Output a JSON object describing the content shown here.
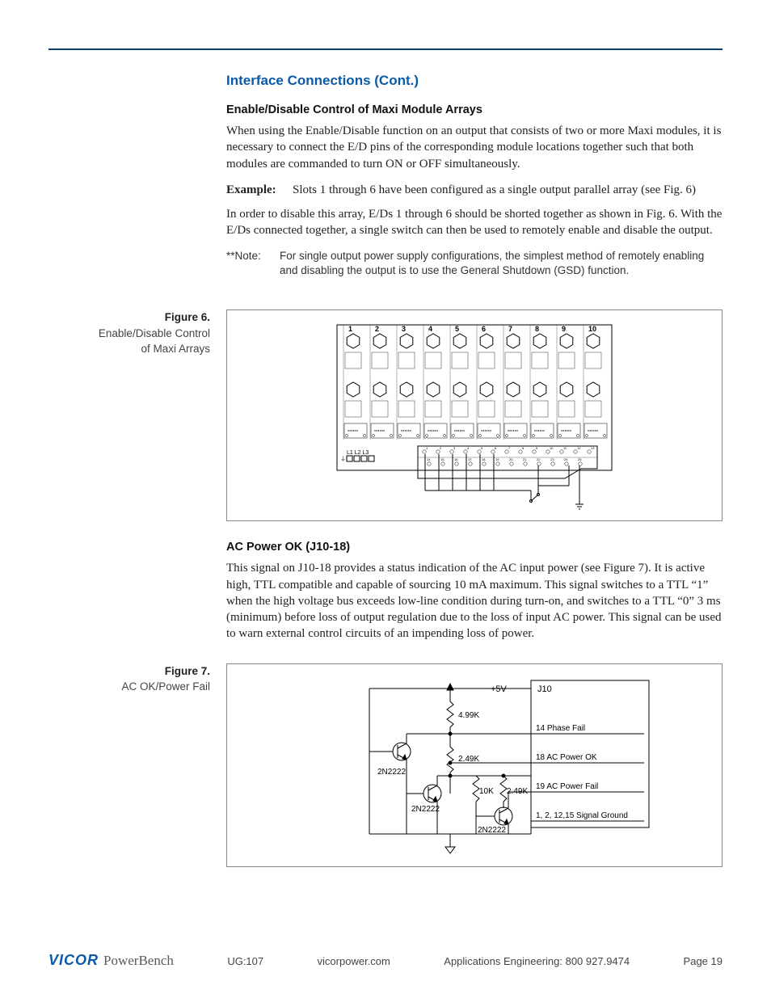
{
  "section_title": "Interface Connections (Cont.)",
  "sub1_title": "Enable/Disable Control of Maxi Module Arrays",
  "para1": "When using the Enable/Disable function on an output that consists of two or more Maxi modules, it is necessary to connect the E/D pins of the corresponding module locations together such that both modules are commanded to turn ON or OFF simultaneously.",
  "example_label": "Example:",
  "example_text": "Slots 1 through 6  have been configured as a single output parallel array (see Fig. 6)",
  "para2": "In order to disable this array, E/Ds 1 through 6 should be shorted together as shown in Fig. 6.  With the E/Ds connected together, a single switch can then be used to remotely enable and disable the output.",
  "note_label": "**Note:",
  "note_text": "For single output power supply configurations, the simplest method of remotely enabling and disabling the output is to use the General Shutdown (GSD) function.",
  "fig6": {
    "num": "Figure 6.",
    "caption_l1": "Enable/Disable Control",
    "caption_l2": "of Maxi Arrays",
    "slot_labels": [
      "1",
      "2",
      "3",
      "4",
      "5",
      "6",
      "7",
      "8",
      "9",
      "10"
    ],
    "ac_labels": "L1 L2 L3",
    "terminal_top": [
      "1",
      "2",
      "3",
      "4",
      "5",
      "6",
      "7",
      "8",
      "9",
      "10",
      "11",
      "12",
      "13"
    ],
    "terminal_bot": [
      "14",
      "15",
      "16",
      "17",
      "18",
      "19",
      "20",
      "21",
      "22",
      "23",
      "24",
      "25"
    ],
    "gnd": "⏚"
  },
  "sub2_title": "AC Power OK (J10-18)",
  "para3": "This signal on J10-18 provides a status indication of the AC input power (see Figure 7). It is active high, TTL compatible and capable of sourcing 10 mA maximum. This signal switches to a TTL “1” when the high voltage bus exceeds low-line condition during turn-on, and switches to a TTL “0” 3 ms (minimum) before loss of output regulation due to the loss of input AC power. This signal can be used to warn external control circuits of an impending loss of power.",
  "fig7": {
    "num": "Figure 7.",
    "caption": "AC OK/Power Fail",
    "v5": "+5V",
    "r1": "4.99K",
    "r2": "2.49K",
    "r3": "10K",
    "r4": "2.49K",
    "q": "2N2222",
    "j10": "J10",
    "s14": "14 Phase Fail",
    "s18": "18 AC Power OK",
    "s19": "19 AC Power Fail",
    "sg": "1, 2, 12,15 Signal Ground"
  },
  "footer": {
    "brand1": "VICOR",
    "brand2": "PowerBench",
    "doc": "UG:107",
    "site": "vicorpower.com",
    "phone": "Applications Engineering: 800 927.9474",
    "page": "Page 19"
  }
}
